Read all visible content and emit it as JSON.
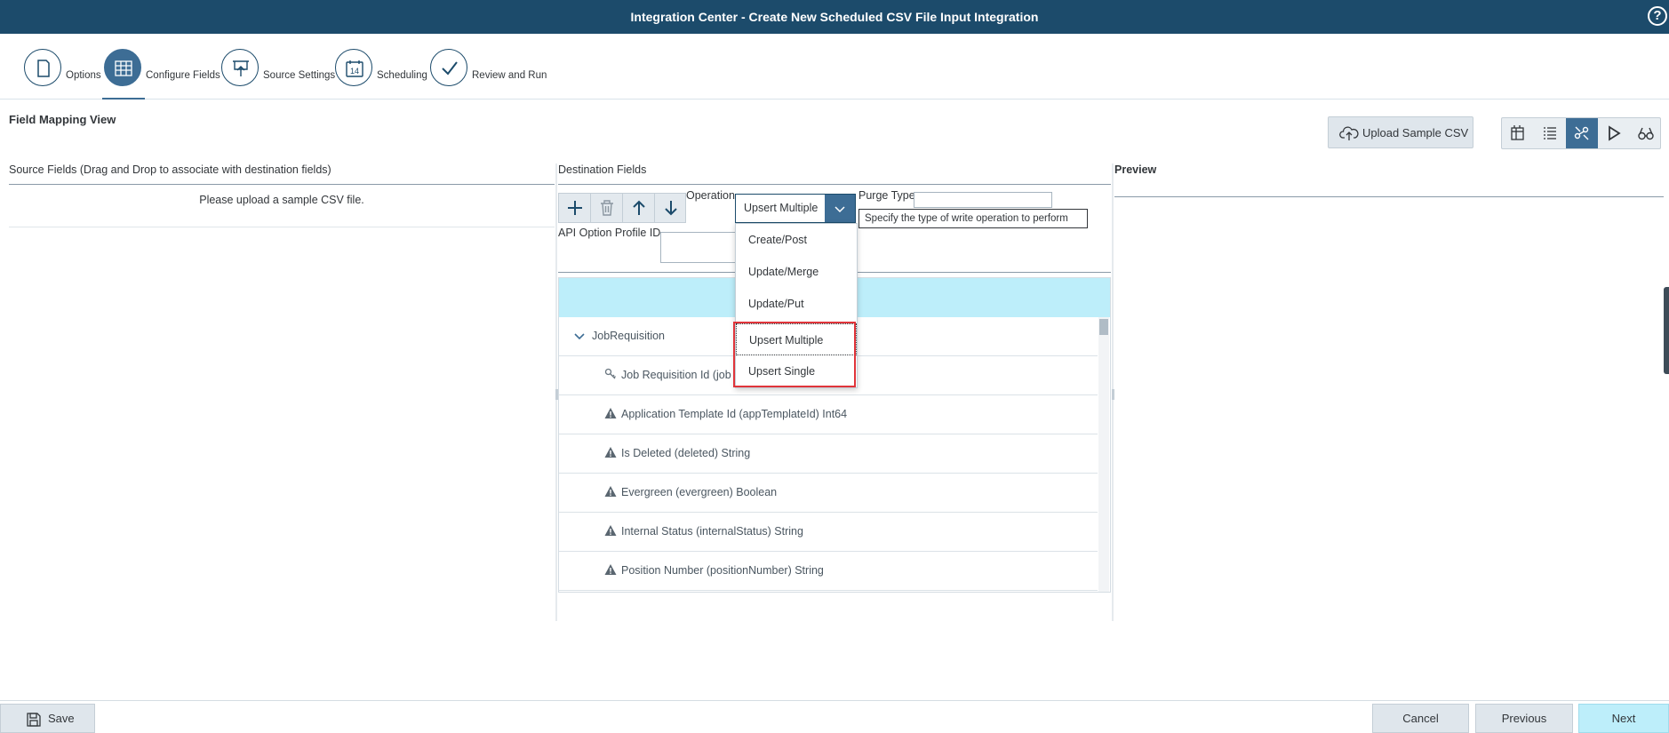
{
  "shell": {
    "title": "Integration Center - Create New Scheduled CSV File Input Integration",
    "help": "?"
  },
  "steps": [
    {
      "label": "Options",
      "icon": "document-icon"
    },
    {
      "label": "Configure Fields",
      "icon": "grid-icon",
      "active": true
    },
    {
      "label": "Source Settings",
      "icon": "upload-board-icon"
    },
    {
      "label": "Scheduling",
      "icon": "calendar-icon"
    },
    {
      "label": "Review and Run",
      "icon": "check-icon"
    }
  ],
  "calendar_day": "14",
  "main": {
    "title": "Field Mapping View",
    "upload_label": "Upload Sample CSV",
    "source_header": "Source Fields (Drag and Drop to associate with destination fields)",
    "source_message": "Please upload a sample CSV file.",
    "destination_header": "Destination Fields",
    "preview_header": "Preview"
  },
  "destination": {
    "operation_label": "Operation",
    "operation_value": "Upsert Multiple",
    "purge_label": "Purge Type",
    "api_label": "API Option Profile ID",
    "tooltip": "Specify the type of write operation to perform",
    "operation_options": [
      "Create/Post",
      "Update/Merge",
      "Update/Put",
      "Upsert Multiple",
      "Upsert Single"
    ]
  },
  "table": {
    "entity": "JobRequisition",
    "rows": [
      {
        "text": "Job Requisition Id (job",
        "icon": "key-icon"
      },
      {
        "text": "Application Template Id (appTemplateId) Int64",
        "icon": "warning-icon"
      },
      {
        "text": "Is Deleted (deleted) String",
        "icon": "warning-icon"
      },
      {
        "text": "Evergreen (evergreen) Boolean",
        "icon": "warning-icon"
      },
      {
        "text": "Internal Status (internalStatus) String",
        "icon": "warning-icon"
      },
      {
        "text": "Position Number (positionNumber) String",
        "icon": "warning-icon"
      }
    ]
  },
  "footer": {
    "save": "Save",
    "cancel": "Cancel",
    "previous": "Previous",
    "next": "Next"
  },
  "colors": {
    "shell": "#1c4b6b",
    "accent": "#3d6d95",
    "highlight": "#e0343a",
    "header_row": "#bdeefa"
  }
}
